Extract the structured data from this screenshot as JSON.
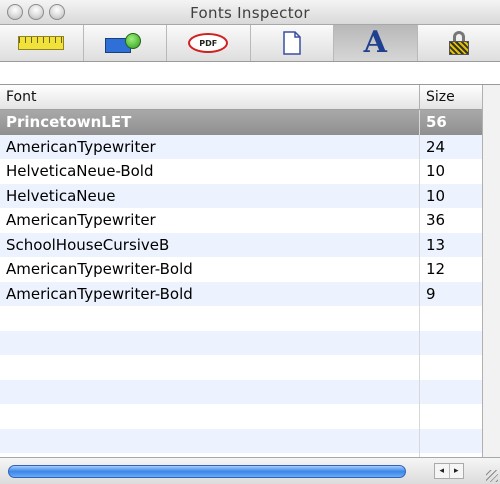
{
  "window": {
    "title": "Fonts Inspector"
  },
  "toolbar": {
    "tabs": [
      {
        "icon": "ruler-icon"
      },
      {
        "icon": "color-swatch-icon"
      },
      {
        "icon": "pdf-icon",
        "label": "PDF"
      },
      {
        "icon": "document-icon"
      },
      {
        "icon": "font-a-icon",
        "label": "A",
        "selected": true
      },
      {
        "icon": "lock-icon"
      }
    ]
  },
  "table": {
    "headers": {
      "font": "Font",
      "size": "Size"
    },
    "rows": [
      {
        "font": "PrincetownLET",
        "size": "56",
        "selected": true
      },
      {
        "font": "AmericanTypewriter",
        "size": "24"
      },
      {
        "font": "HelveticaNeue-Bold",
        "size": "10"
      },
      {
        "font": "HelveticaNeue",
        "size": "10"
      },
      {
        "font": "AmericanTypewriter",
        "size": "36"
      },
      {
        "font": "SchoolHouseCursiveB",
        "size": "13"
      },
      {
        "font": "AmericanTypewriter-Bold",
        "size": "12"
      },
      {
        "font": "AmericanTypewriter-Bold",
        "size": "9"
      }
    ]
  },
  "scrollbar": {
    "left_arrow": "◂",
    "right_arrow": "▸"
  },
  "colors": {
    "selection": "#999999",
    "stripe": "#edf3fe",
    "accent": "#3a87e8"
  }
}
